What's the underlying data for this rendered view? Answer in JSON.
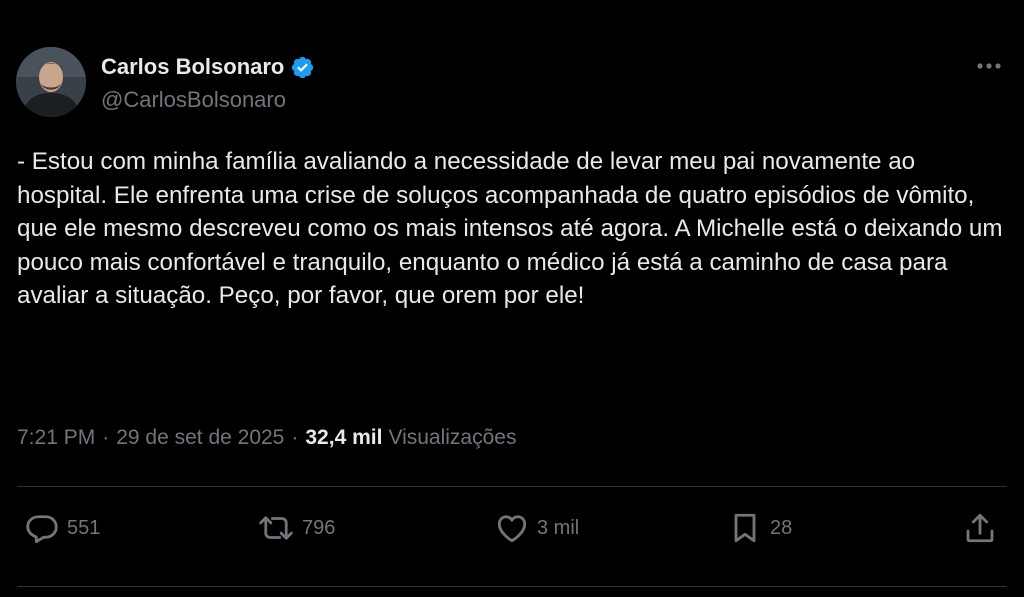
{
  "author": {
    "display_name": "Carlos Bolsonaro",
    "handle": "@CarlosBolsonaro",
    "verified": true
  },
  "tweet": {
    "text": "- Estou com minha família avaliando a necessidade de levar meu pai novamente ao hospital. Ele enfrenta uma crise de soluços acompanhada de quatro episódios de vômito, que ele mesmo descreveu como os mais intensos até agora. A Michelle está o deixando um pouco mais confortável e tranquilo, enquanto o médico já está a caminho de casa para avaliar a situação. Peço, por favor, que orem por ele!",
    "time": "7:21 PM",
    "separator": "·",
    "date": "29 de set de 2025",
    "views_count": "32,4 mil",
    "views_label": "Visualizações"
  },
  "actions": {
    "replies": "551",
    "reposts": "796",
    "likes": "3 mil",
    "bookmarks": "28"
  },
  "colors": {
    "background": "#000000",
    "text": "#e7e9ea",
    "secondary": "#71767b",
    "verified": "#1d9bf0",
    "divider": "#2f3336"
  },
  "icons": {
    "more": "more-dots-icon",
    "reply": "reply-bubble-icon",
    "repost": "repost-arrows-icon",
    "like": "heart-icon",
    "bookmark": "bookmark-icon",
    "share": "share-upload-icon",
    "verified": "verified-badge-icon"
  }
}
